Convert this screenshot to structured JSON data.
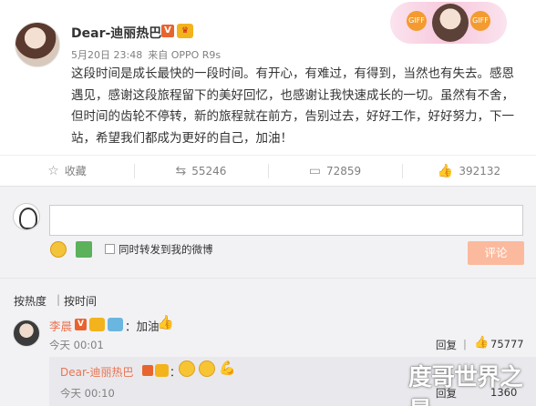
{
  "post": {
    "username": "Dear-迪丽热巴",
    "verified_label": "V",
    "date": "5月20日 23:48",
    "source": "来自 OPPO R9s",
    "text": "这段时间是成长最快的一段时间。有开心，有难过，有得到，当然也有失去。感恩遇见，感谢这段旅程留下的美好回忆，也感谢让我快速成长的一切。虽然有不舍，但时间的齿轮不停转，新的旅程就在前方，告别过去，好好工作，好好努力，下一站，希望我们都成为更好的自己，加油！",
    "card_sticker_left": "GIFF",
    "card_sticker_right": "GIFF"
  },
  "actions": [
    {
      "icon": "star-icon",
      "glyph": "☆",
      "label": "收藏"
    },
    {
      "icon": "repost-icon",
      "glyph": "⇆",
      "label": "55246"
    },
    {
      "icon": "comment-icon",
      "glyph": "▭",
      "label": "72859"
    },
    {
      "icon": "like-icon",
      "glyph": "👍",
      "label": "392132"
    }
  ],
  "composer": {
    "input_value": "",
    "repost_checkbox_label": "同时转发到我的微博",
    "submit_label": "评论"
  },
  "sort": {
    "hot": "按热度",
    "separator": "|",
    "time": "按时间"
  },
  "comment": {
    "user": "李晨",
    "text": "：加油",
    "time": "今天 00:01",
    "reply": "回复",
    "likes": "75777"
  },
  "reply": {
    "user": "Dear-迪丽热巴",
    "colon": "：",
    "time": "今天 00:10",
    "reply": "回复",
    "likes": "1360"
  },
  "watermark": "度哥世界之最",
  "colors": {
    "accent": "#eb7350",
    "button": "#fbba9d",
    "verified": "#e8642e"
  }
}
